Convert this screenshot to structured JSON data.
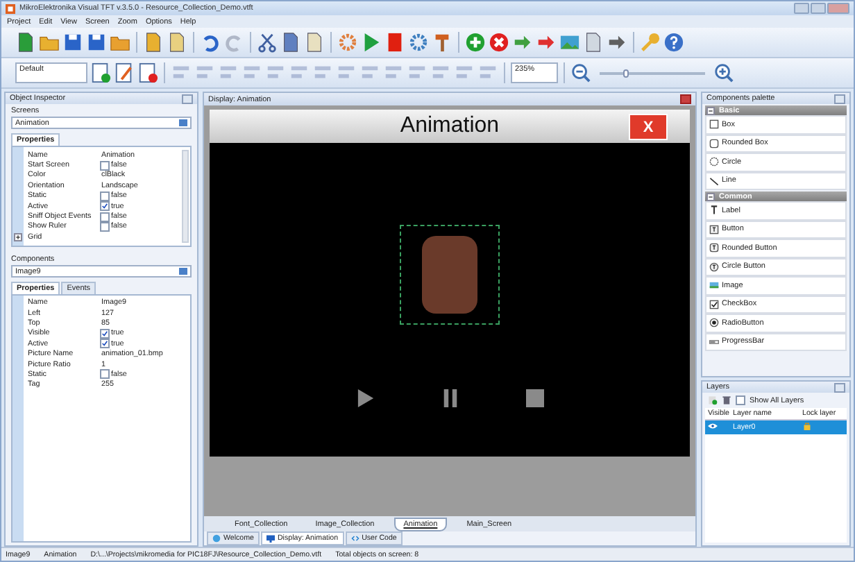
{
  "window": {
    "title": "MikroElektronika Visual TFT v.3.5.0 - Resource_Collection_Demo.vtft"
  },
  "menu": [
    "Project",
    "Edit",
    "View",
    "Screen",
    "Zoom",
    "Options",
    "Help"
  ],
  "toolbar": {
    "scheme": "Default",
    "zoom": {
      "value": "235%",
      "level": 0.25
    }
  },
  "object_inspector": {
    "title": "Object Inspector",
    "screens_label": "Screens",
    "screen": "Animation",
    "screen_tabs": [
      {
        "label": "Properties",
        "selected": true
      }
    ],
    "screen_properties": [
      {
        "name": "Name",
        "kind": "text",
        "value": "Animation"
      },
      {
        "name": "Start Screen",
        "kind": "check",
        "value": "false",
        "checked": false
      },
      {
        "name": "Color",
        "kind": "text",
        "value": "clBlack"
      },
      {
        "name": "Orientation",
        "kind": "text",
        "value": "Landscape"
      },
      {
        "name": "Static",
        "kind": "check",
        "value": "false",
        "checked": false
      },
      {
        "name": "Active",
        "kind": "check",
        "value": "true",
        "checked": true
      },
      {
        "name": "Sniff Object Events",
        "kind": "check",
        "value": "false",
        "checked": false
      },
      {
        "name": "Show Ruler",
        "kind": "check",
        "value": "false",
        "checked": false
      },
      {
        "name": "Grid",
        "kind": "group",
        "expanded": false
      }
    ],
    "components_label": "Components",
    "component": "Image9",
    "component_tabs": [
      {
        "label": "Properties",
        "selected": true
      },
      {
        "label": "Events",
        "selected": false
      }
    ],
    "component_properties": [
      {
        "name": "Name",
        "kind": "text",
        "value": "Image9"
      },
      {
        "name": "Left",
        "kind": "text",
        "value": "127"
      },
      {
        "name": "Top",
        "kind": "text",
        "value": "85"
      },
      {
        "name": "Visible",
        "kind": "check",
        "value": "true",
        "checked": true
      },
      {
        "name": "Active",
        "kind": "check",
        "value": "true",
        "checked": true
      },
      {
        "name": "Picture Name",
        "kind": "text",
        "value": "animation_01.bmp"
      },
      {
        "name": "Picture Ratio",
        "kind": "text",
        "value": "1"
      },
      {
        "name": "Static",
        "kind": "check",
        "value": "false",
        "checked": false
      },
      {
        "name": "Tag",
        "kind": "text",
        "value": "255"
      }
    ]
  },
  "designer": {
    "title": "Display: Animation",
    "screen_title": "Animation",
    "close_label": "X",
    "screen_tabs": [
      {
        "label": "Font_Collection",
        "selected": false
      },
      {
        "label": "Image_Collection",
        "selected": false
      },
      {
        "label": "Animation",
        "selected": true
      },
      {
        "label": "Main_Screen",
        "selected": false
      }
    ],
    "document_tabs": [
      {
        "label": "Welcome",
        "kind": "welcome",
        "selected": false
      },
      {
        "label": "Display: Animation",
        "kind": "display",
        "selected": true
      },
      {
        "label": "User Code",
        "kind": "code",
        "selected": false
      }
    ]
  },
  "palette": {
    "title": "Components palette",
    "groups": [
      {
        "name": "Basic",
        "expanded": true,
        "items": [
          {
            "label": "Box",
            "kind": "box"
          },
          {
            "label": "Rounded Box",
            "kind": "rounded-box"
          },
          {
            "label": "Circle",
            "kind": "circle"
          },
          {
            "label": "Line",
            "kind": "line"
          }
        ]
      },
      {
        "name": "Common",
        "expanded": true,
        "items": [
          {
            "label": "Label",
            "kind": "label"
          },
          {
            "label": "Button",
            "kind": "button"
          },
          {
            "label": "Rounded Button",
            "kind": "rounded-button"
          },
          {
            "label": "Circle Button",
            "kind": "circle-button"
          },
          {
            "label": "Image",
            "kind": "image"
          },
          {
            "label": "CheckBox",
            "kind": "checkbox"
          },
          {
            "label": "RadioButton",
            "kind": "radio"
          },
          {
            "label": "ProgressBar",
            "kind": "progress"
          }
        ]
      }
    ]
  },
  "layers": {
    "title": "Layers",
    "show_all": {
      "label": "Show All Layers",
      "checked": false
    },
    "columns": [
      "Visible",
      "Layer name",
      "Lock layer"
    ],
    "rows": [
      {
        "name": "Layer0",
        "visible": true,
        "selected": true
      }
    ]
  },
  "status_bar": [
    "Image9",
    "Animation",
    "D:\\...\\Projects\\mikromedia for PIC18FJ\\Resource_Collection_Demo.vtft",
    "Total objects on screen: 8"
  ]
}
